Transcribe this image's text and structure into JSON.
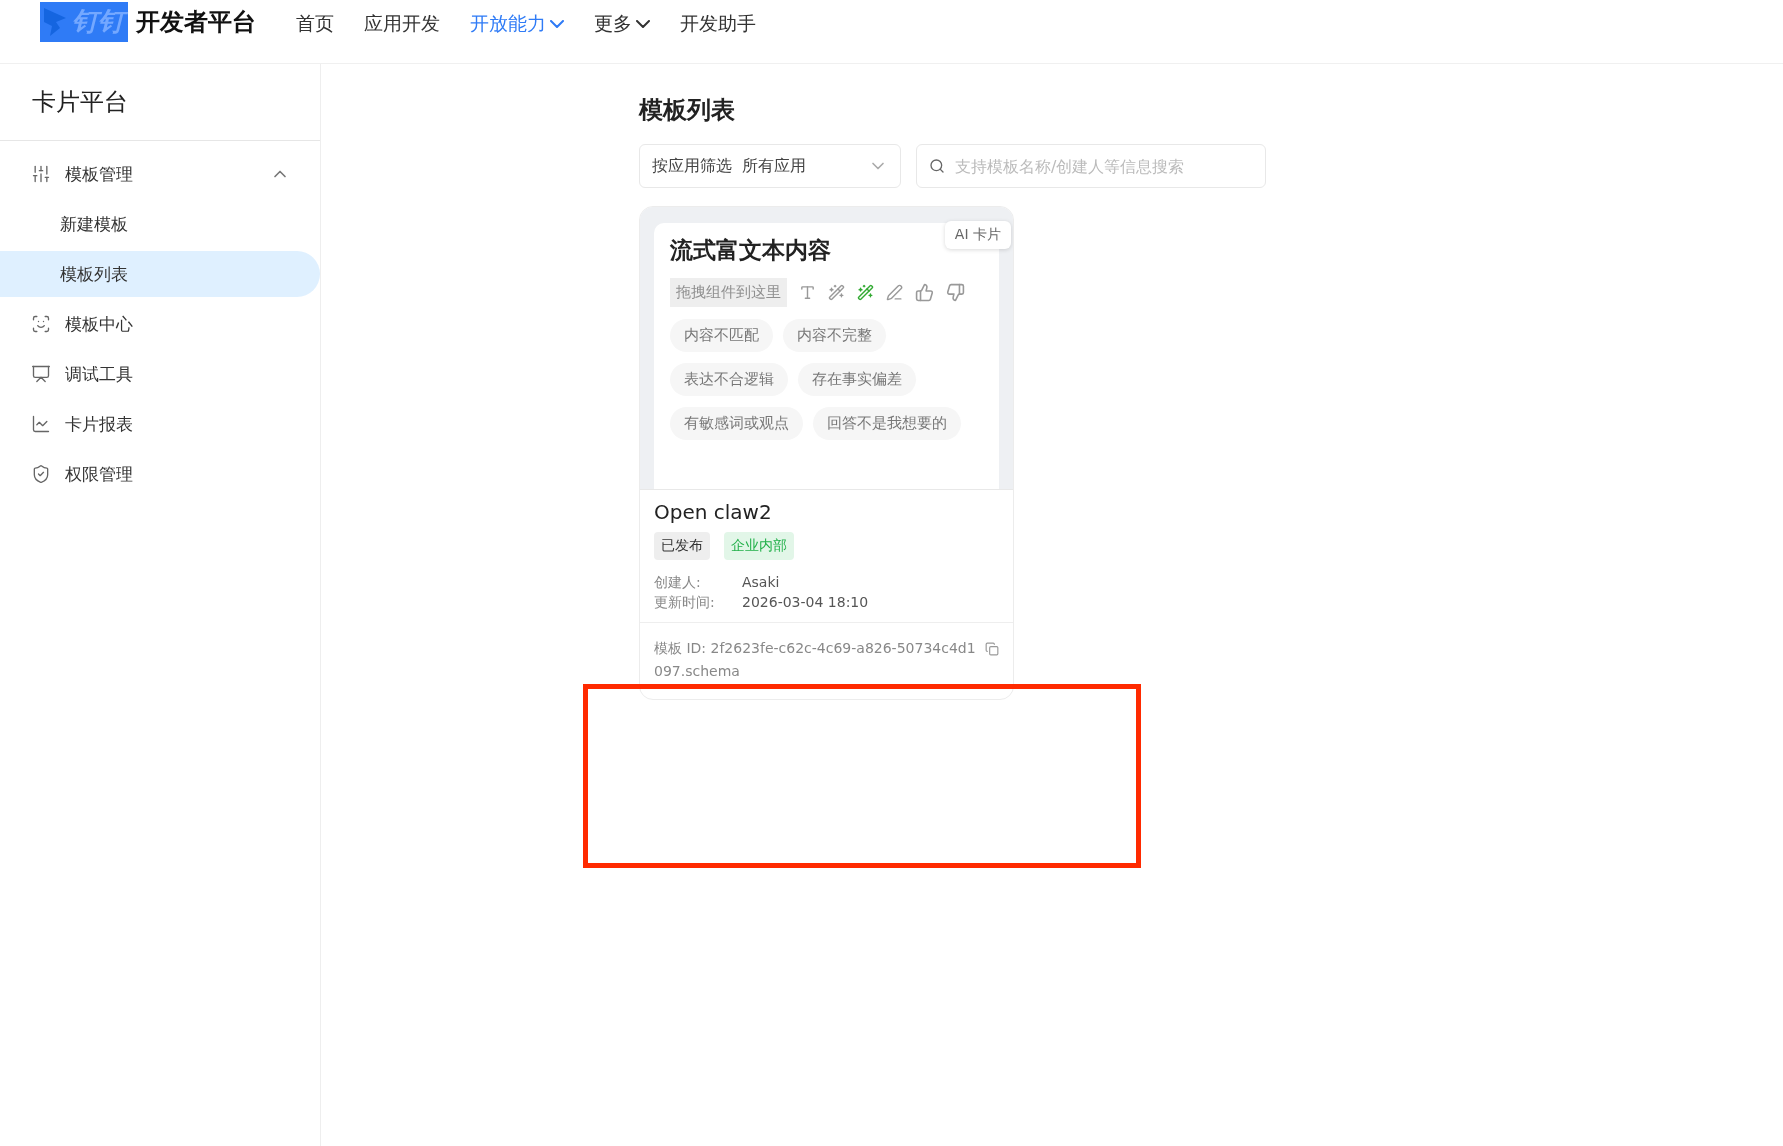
{
  "header": {
    "logo": "钉钉",
    "title": "开发者平台",
    "nav": [
      {
        "label": "首页",
        "selected": false,
        "dropdown": false
      },
      {
        "label": "应用开发",
        "selected": false,
        "dropdown": false
      },
      {
        "label": "开放能力",
        "selected": true,
        "dropdown": true
      },
      {
        "label": "更多",
        "selected": false,
        "dropdown": true
      },
      {
        "label": "开发助手",
        "selected": false,
        "dropdown": false
      }
    ]
  },
  "sidebar": {
    "title": "卡片平台",
    "items": [
      {
        "label": "模板管理",
        "selected": false,
        "expanded": true,
        "children": [
          {
            "label": "新建模板",
            "selected": false
          },
          {
            "label": "模板列表",
            "selected": true
          }
        ]
      },
      {
        "label": "模板中心",
        "selected": false
      },
      {
        "label": "调试工具",
        "selected": false
      },
      {
        "label": "卡片报表",
        "selected": false
      },
      {
        "label": "权限管理",
        "selected": false
      }
    ]
  },
  "main": {
    "title": "模板列表",
    "filter": {
      "label": "按应用筛选",
      "value": "所有应用"
    },
    "search": {
      "placeholder": "支持模板名称/创建人等信息搜索"
    },
    "cards": [
      {
        "preview": {
          "badge": "AI 卡片",
          "title": "流式富文本内容",
          "drop_hint": "拖拽组件到这里",
          "tags": [
            "内容不匹配",
            "内容不完整",
            "表达不合逻辑",
            "存在事实偏差",
            "有敏感词或观点",
            "回答不是我想要的"
          ]
        },
        "name": "Open claw2",
        "badges": [
          {
            "label": "已发布",
            "kind": "neutral"
          },
          {
            "label": "企业内部",
            "kind": "success"
          }
        ],
        "fields": [
          {
            "label": "创建人:",
            "value": "Asaki"
          },
          {
            "label": "更新时间:",
            "value": "2026-03-04 18:10"
          }
        ],
        "id_label": "模板 ID:",
        "id_value": "2f2623fe-c62c-4c69-a826-50734c4d1097.schema"
      }
    ]
  },
  "annotation": {
    "highlighted": true
  }
}
